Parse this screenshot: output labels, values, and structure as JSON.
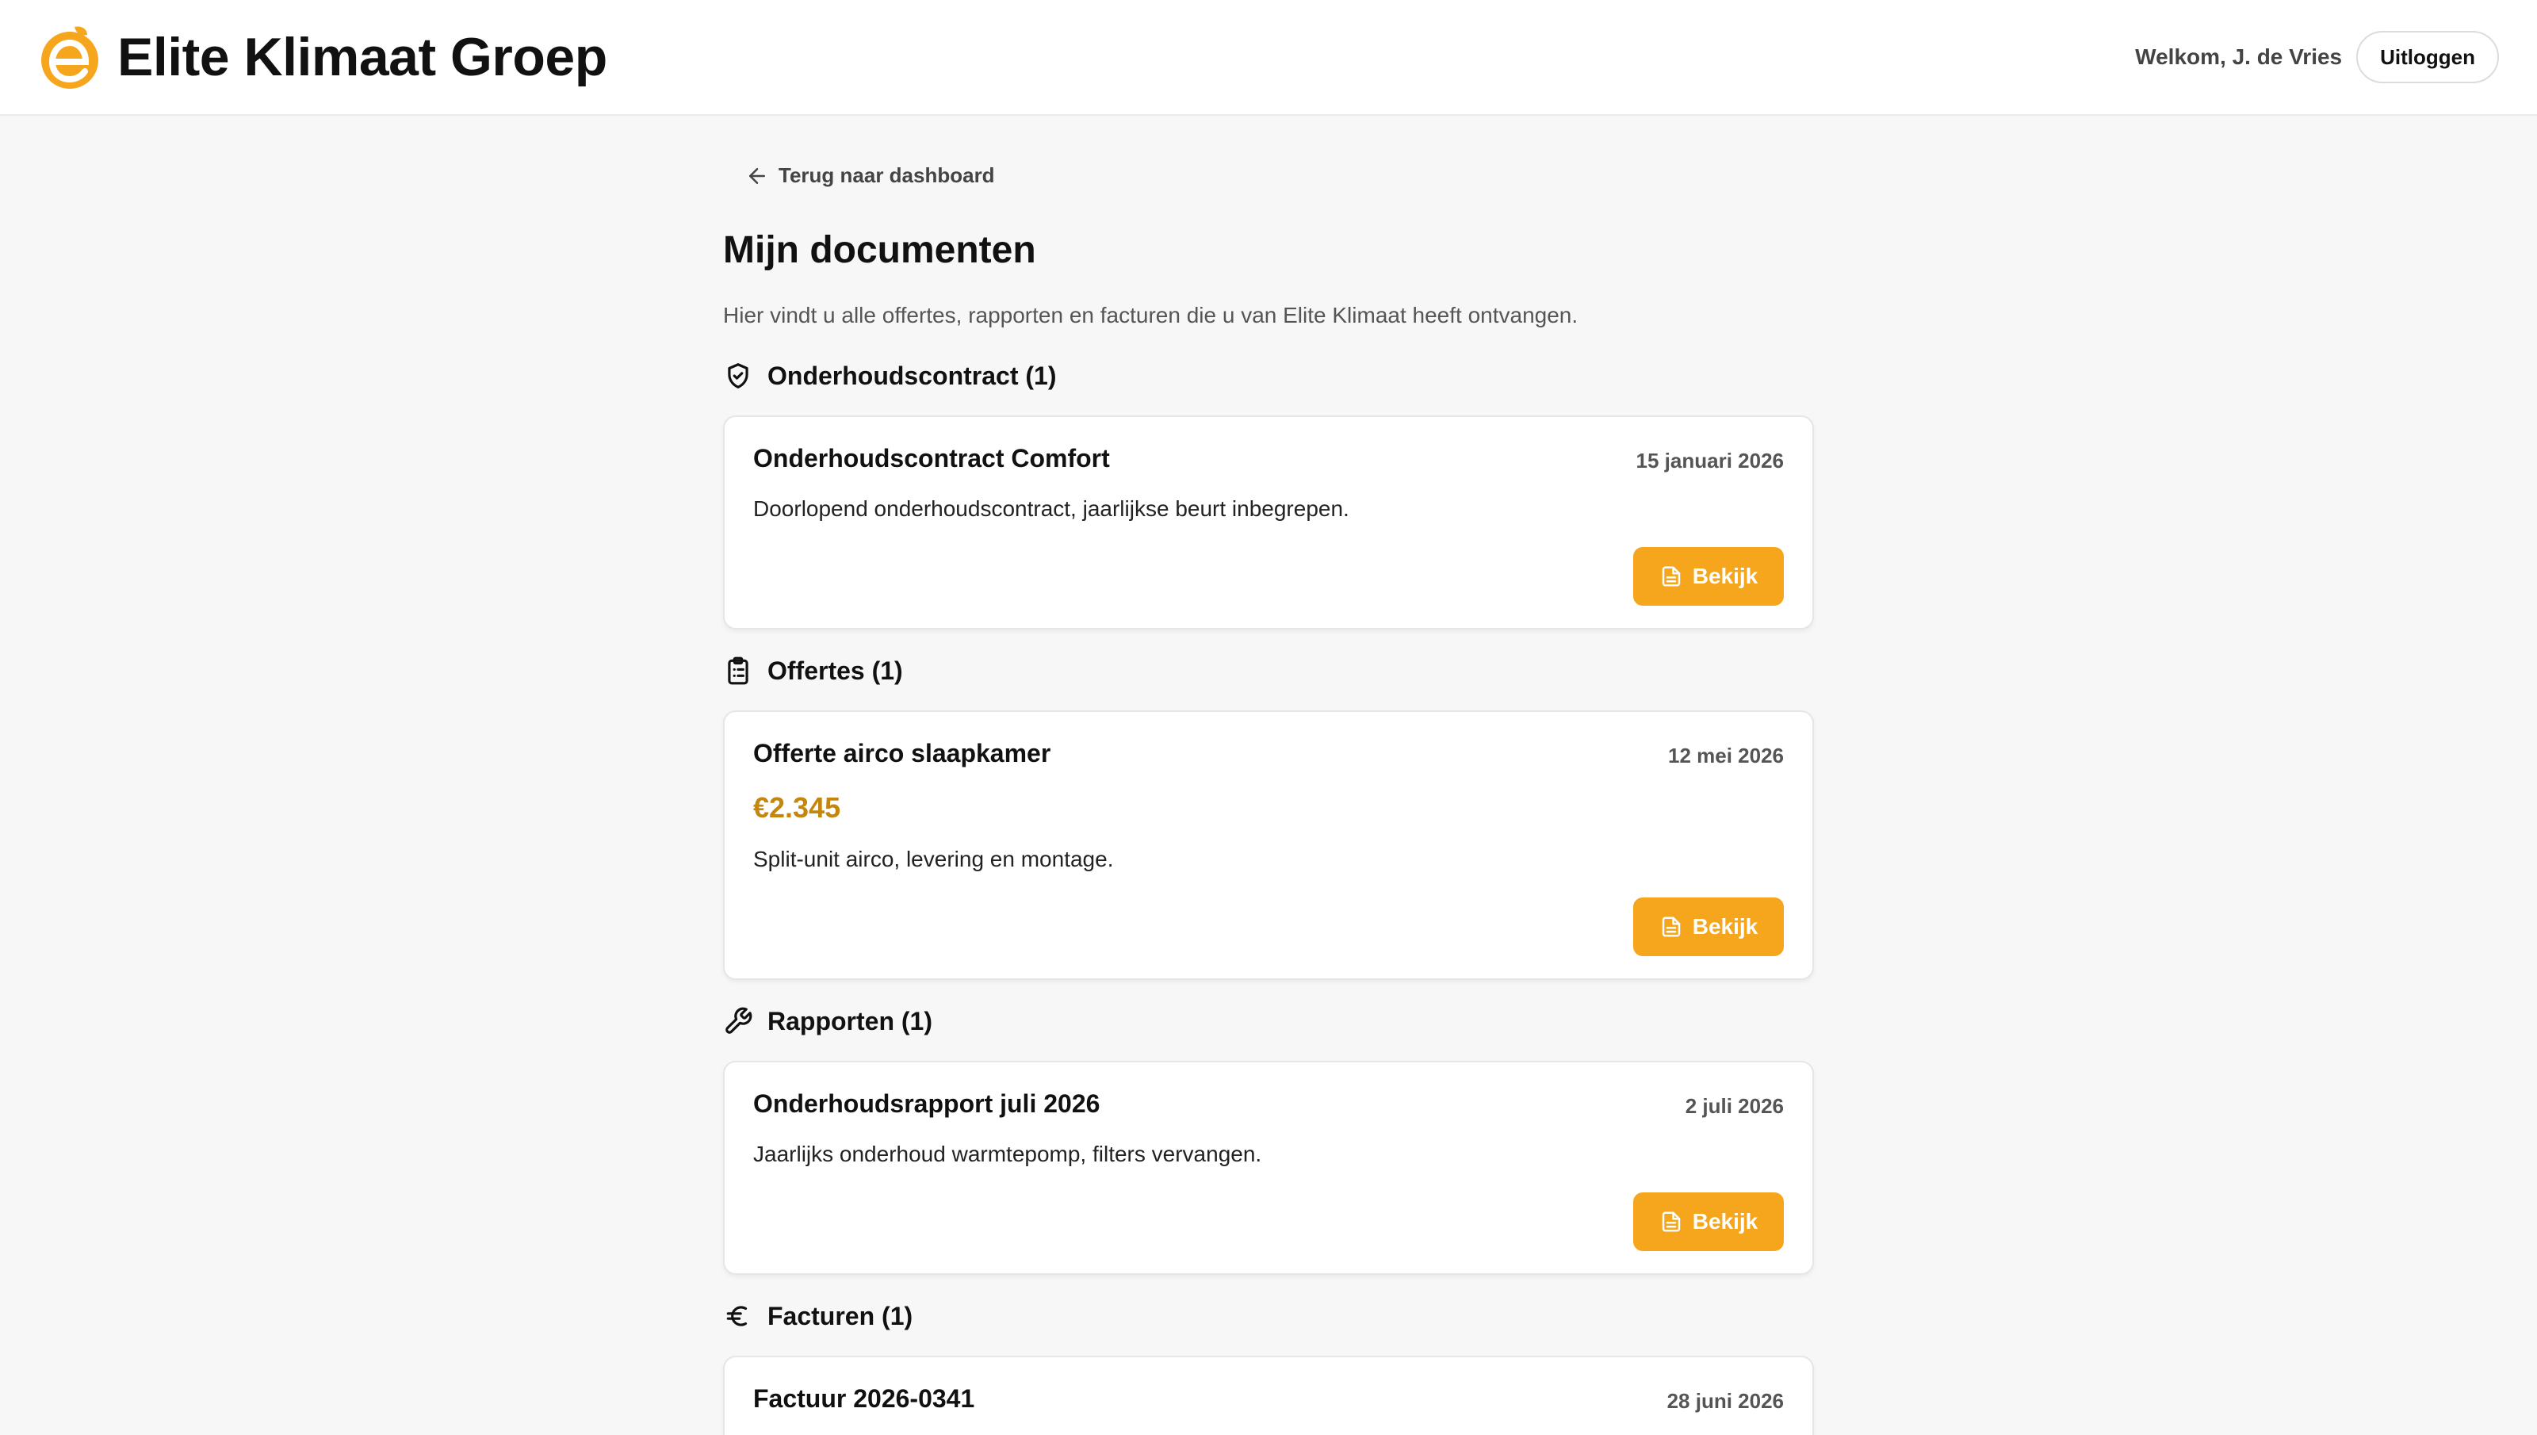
{
  "brand": {
    "name": "Elite Klimaat Groep",
    "accent": "#f6a61d"
  },
  "header": {
    "welcome": "Welkom, J. de Vries",
    "logout_label": "Uitloggen"
  },
  "page": {
    "back_label": "Terug naar dashboard",
    "title": "Mijn documenten",
    "description": "Hier vindt u alle offertes, rapporten en facturen die u van Elite Klimaat heeft ontvangen."
  },
  "sections": [
    {
      "title": "Onderhoudscontract (1)",
      "icon": "shield-check-icon",
      "items": [
        {
          "title": "Onderhoudscontract Comfort",
          "date": "15 januari 2026",
          "description": "Doorlopend onderhoudscontract, jaarlijkse beurt inbegrepen.",
          "button": "Bekijk"
        }
      ]
    },
    {
      "title": "Offertes (1)",
      "icon": "clipboard-list-icon",
      "items": [
        {
          "title": "Offerte airco slaapkamer",
          "date": "12 mei 2026",
          "amount": "€2.345",
          "description": "Split-unit airco, levering en montage.",
          "button": "Bekijk"
        }
      ]
    },
    {
      "title": "Rapporten (1)",
      "icon": "wrench-icon",
      "items": [
        {
          "title": "Onderhoudsrapport juli 2026",
          "date": "2 juli 2026",
          "description": "Jaarlijks onderhoud warmtepomp, filters vervangen.",
          "button": "Bekijk"
        }
      ]
    },
    {
      "title": "Facturen (1)",
      "icon": "euro-icon",
      "items": [
        {
          "title": "Factuur 2026-0341",
          "date": "28 juni 2026"
        }
      ]
    }
  ]
}
